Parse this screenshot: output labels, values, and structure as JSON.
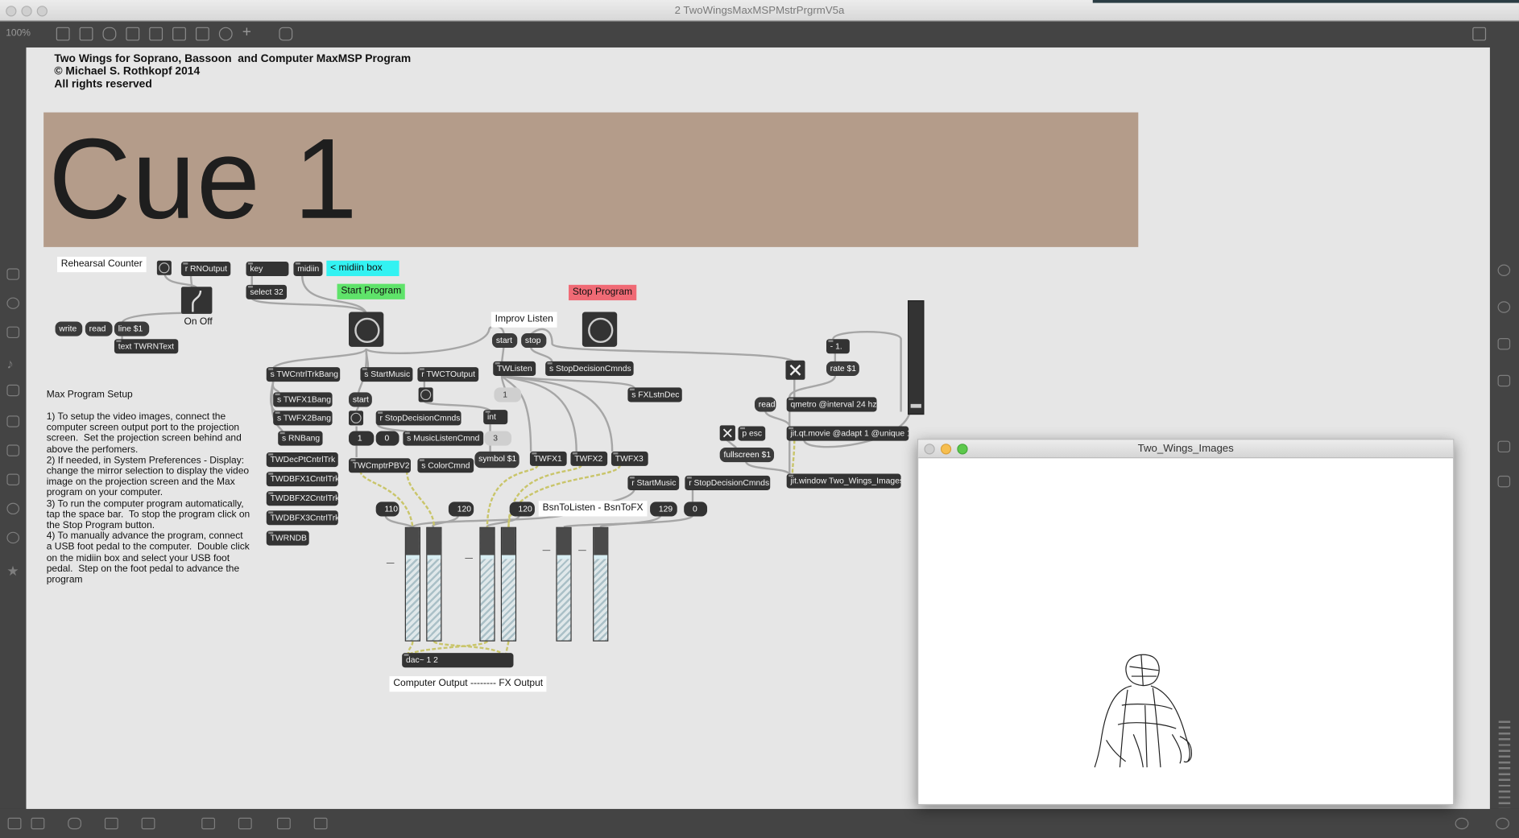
{
  "window": {
    "title": "2 TwoWingsMaxMSPMstrPrgrmV5a"
  },
  "toolbar": {
    "zoom": "100%"
  },
  "patch": {
    "title": "Two Wings for Soprano, Bassoon  and Computer MaxMSP Program\n© Michael S. Rothkopf 2014\nAll rights reserved",
    "cue": "Cue 1",
    "rehearsal_counter": "Rehearsal Counter",
    "midiin_box": "< midiin box",
    "start_program": "Start Program",
    "stop_program": "Stop Program",
    "improv_listen": "Improv Listen",
    "on_off": "On  Off",
    "bsn_to_listen": "BsnToListen - BsnToFX",
    "computer_output": "Computer Output -------- FX Output",
    "setup_title": "Max Program Setup",
    "setup_text": "1) To setup the video images, connect the computer screen output port to the projection screen.  Set the projection screen behind and above the perfomers.\n2) If needed, in System Preferences - Display: change the mirror selection to display the video image on the projection screen and the Max program on your computer.\n3) To run the computer program automatically, tap the space bar.  To stop the program click on the Stop Program button.\n4) To manually advance the program, connect a USB foot pedal to the computer.  Double click on the midiin box and select your USB foot pedal.  Step on the foot pedal to advance the program",
    "objects": {
      "r_rnoutput": "r RNOutput",
      "key": "key",
      "midiin": "midiin",
      "select32": "select 32",
      "write": "write",
      "read": "read",
      "line1": "line $1",
      "text_twrn": "text TWRNText",
      "s_twcntrl": "s TWCntrlTrkBang",
      "s_startmusic": "s StartMusic",
      "r_twctoutput": "r TWCTOutput",
      "s_twfx1": "s TWFX1Bang",
      "s_twfx2": "s TWFX2Bang",
      "s_rnbang": "s RNBang",
      "twdecpt": "TWDecPtCntrlTrk",
      "twdbfx1": "TWDBFX1CntrlTrk",
      "twdbfx2": "TWDBFX2CntrlTrk",
      "twdbfx3": "TWDBFX3CntrlTrk",
      "twrndb": "TWRNDB",
      "start": "start",
      "r_stopdec": "r StopDecisionCmnds",
      "int": "int",
      "s_musiclisten": "s MusicListenCmnd",
      "twcmptr": "TWCmptrPBV2",
      "s_colorcmnd": "s ColorCmnd",
      "symbol1": "symbol $1",
      "twfx1": "TWFX1",
      "twfx2": "TWFX2",
      "twfx3": "TWFX3",
      "improv_start": "start",
      "improv_stop": "stop",
      "twlisten": "TWListen",
      "s_stopdec": "s StopDecisionCmnds",
      "s_fxlstn": "s FXLstnDec",
      "r_startmusic": "r StartMusic",
      "r_stopdec2": "r StopDecisionCmnds",
      "minus1": "- 1.",
      "rate1": "rate $1",
      "read2": "read",
      "qmetro": "qmetro @interval 24 hz",
      "p_esc": "p esc",
      "jit_qt": "jit.qt.movie @adapt 1 @unique 1",
      "fullscreen": "fullscreen $1",
      "jit_window": "jit.window Two_Wings_Images",
      "dac": "dac~ 1 2"
    },
    "numbers": {
      "n_one": "1",
      "n_int1": "1",
      "n_zero": "0",
      "n_three": "3",
      "n110": "110",
      "n120a": "120",
      "n120b": "120",
      "n129": "129",
      "n0": "0"
    }
  },
  "jitter_window": {
    "title": "Two_Wings_Images"
  },
  "colors": {
    "cue_panel": "#b49c8a",
    "start_button": "#5fe36a",
    "stop_button": "#f06a75",
    "midiin_label": "#33f2f2",
    "canvas": "#e6e6e6",
    "object": "#333333"
  }
}
